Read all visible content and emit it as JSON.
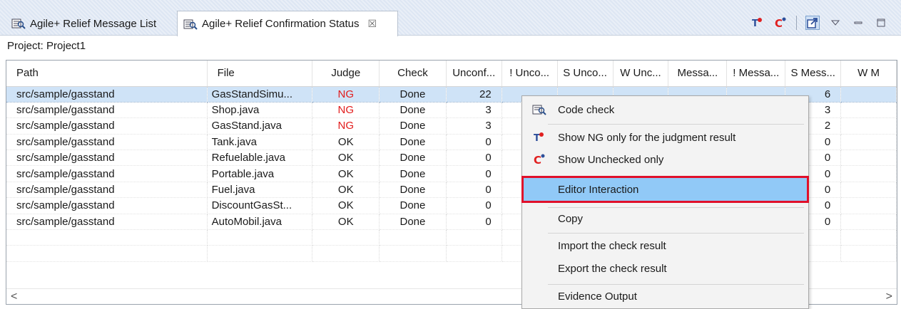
{
  "tabs": [
    {
      "label": "Agile+ Relief Message List",
      "active": false
    },
    {
      "label": "Agile+ Relief Confirmation Status",
      "active": true,
      "close": "☒"
    }
  ],
  "toolbar": {
    "icons": [
      "ng-filter-icon",
      "unchecked-filter-icon",
      "editor-link-icon",
      "view-menu-icon",
      "minimize-icon",
      "maximize-icon"
    ]
  },
  "project": {
    "label": "Project:",
    "value": "Project1"
  },
  "table": {
    "columns": [
      "Path",
      "File",
      "Judge",
      "Check",
      "Unconf...",
      "! Unco...",
      "S Unco...",
      "W Unc...",
      "Messa...",
      "! Messa...",
      "S Mess...",
      "W M"
    ],
    "rows": [
      {
        "path": "src/sample/gasstand",
        "file": "GasStandSimu...",
        "judge": "NG",
        "check": "Done",
        "unconf": "22",
        "smess": "6"
      },
      {
        "path": "src/sample/gasstand",
        "file": "Shop.java",
        "judge": "NG",
        "check": "Done",
        "unconf": "3",
        "smess": "3"
      },
      {
        "path": "src/sample/gasstand",
        "file": "GasStand.java",
        "judge": "NG",
        "check": "Done",
        "unconf": "3",
        "smess": "2"
      },
      {
        "path": "src/sample/gasstand",
        "file": "Tank.java",
        "judge": "OK",
        "check": "Done",
        "unconf": "0",
        "smess": "0"
      },
      {
        "path": "src/sample/gasstand",
        "file": "Refuelable.java",
        "judge": "OK",
        "check": "Done",
        "unconf": "0",
        "smess": "0"
      },
      {
        "path": "src/sample/gasstand",
        "file": "Portable.java",
        "judge": "OK",
        "check": "Done",
        "unconf": "0",
        "smess": "0"
      },
      {
        "path": "src/sample/gasstand",
        "file": "Fuel.java",
        "judge": "OK",
        "check": "Done",
        "unconf": "0",
        "smess": "0"
      },
      {
        "path": "src/sample/gasstand",
        "file": "DiscountGasSt...",
        "judge": "OK",
        "check": "Done",
        "unconf": "0",
        "smess": "0"
      },
      {
        "path": "src/sample/gasstand",
        "file": "AutoMobil.java",
        "judge": "OK",
        "check": "Done",
        "unconf": "0",
        "smess": "0"
      }
    ],
    "scroll_left": "<",
    "scroll_right": ">"
  },
  "context_menu": {
    "items": [
      {
        "label": "Code check",
        "icon": "code-check-icon"
      },
      {
        "label": "Show NG only for the judgment result",
        "icon": "ng-filter-icon"
      },
      {
        "label": "Show Unchecked only",
        "icon": "unchecked-filter-icon"
      },
      {
        "label": "Editor Interaction",
        "highlighted": true
      },
      {
        "label": "Copy"
      },
      {
        "label": "Import the check result"
      },
      {
        "label": "Export the check result"
      },
      {
        "label": "Evidence Output"
      }
    ]
  },
  "colors": {
    "ng": "#e21b1b",
    "selection": "#cfe3f7",
    "menu_highlight": "#91c9f7",
    "highlight_border": "#e0102a"
  }
}
